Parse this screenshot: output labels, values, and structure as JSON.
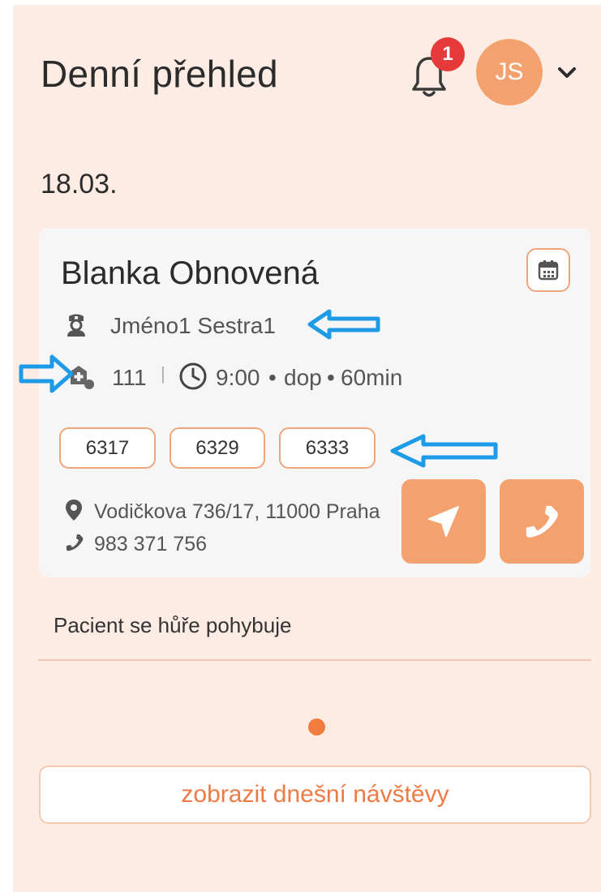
{
  "header": {
    "title": "Denní přehled",
    "notification_count": "1",
    "user_initials": "JS",
    "icons": {
      "bell": "bell-icon",
      "chevron": "chevron-down-icon"
    }
  },
  "date": "18.03.",
  "visit": {
    "patient_name": "Blanka Obnovená",
    "nurse": "Jméno1 Sestra1",
    "code": "111",
    "separator": "|",
    "time": "9:00",
    "period": "dop",
    "duration": "60min",
    "dot": "•",
    "procedures": [
      "6317",
      "6329",
      "6333"
    ],
    "address": "Vodičkova 736/17, 11000 Praha",
    "phone": "983 371 756",
    "note": "Pacient se hůře pohybuje",
    "icons": {
      "calendar": "calendar-icon",
      "nurse": "nurse-icon",
      "medical": "medical-case-icon",
      "clock": "clock-icon",
      "pin": "map-pin-icon",
      "phone": "phone-icon",
      "navigate": "navigation-arrow-icon"
    }
  },
  "show_today_label": "zobrazit dnešní návštěvy",
  "colors": {
    "background": "#fdece3",
    "accent": "#f4a170",
    "accent_text": "#ee7a45",
    "badge": "#e63a3a",
    "annotation_arrow": "#1e9be6"
  }
}
